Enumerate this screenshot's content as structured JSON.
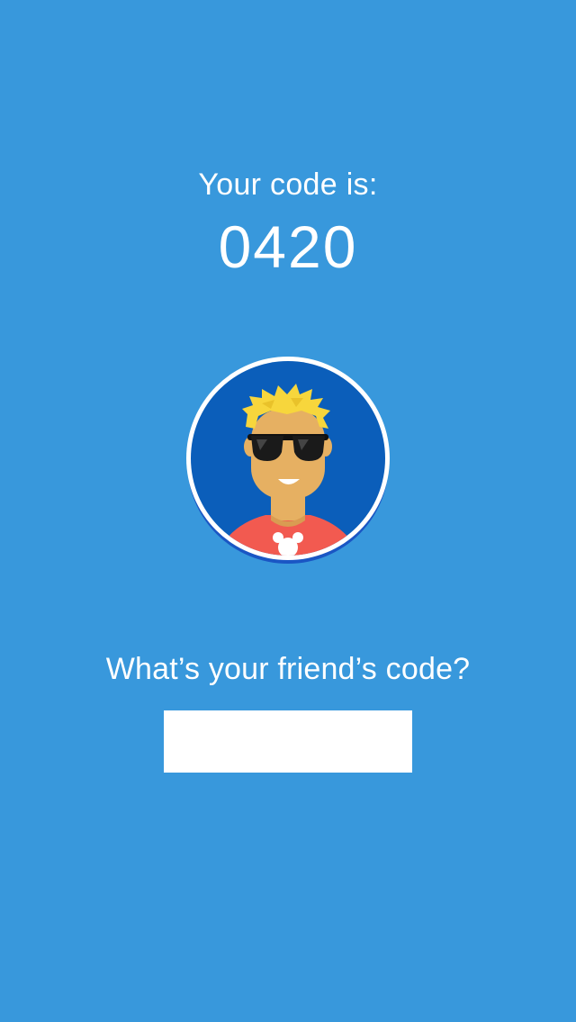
{
  "screen": {
    "background_color": "#3898DC"
  },
  "own_code": {
    "label": "Your code is:",
    "value": "0420"
  },
  "avatar": {
    "icon": "cool-guy-avatar-icon",
    "background_color": "#0B5EBA",
    "hair_color": "#F7D63C",
    "shirt_color": "#F25A50"
  },
  "friend_code": {
    "label": "What’s your friend’s code?",
    "value": "",
    "placeholder": ""
  }
}
